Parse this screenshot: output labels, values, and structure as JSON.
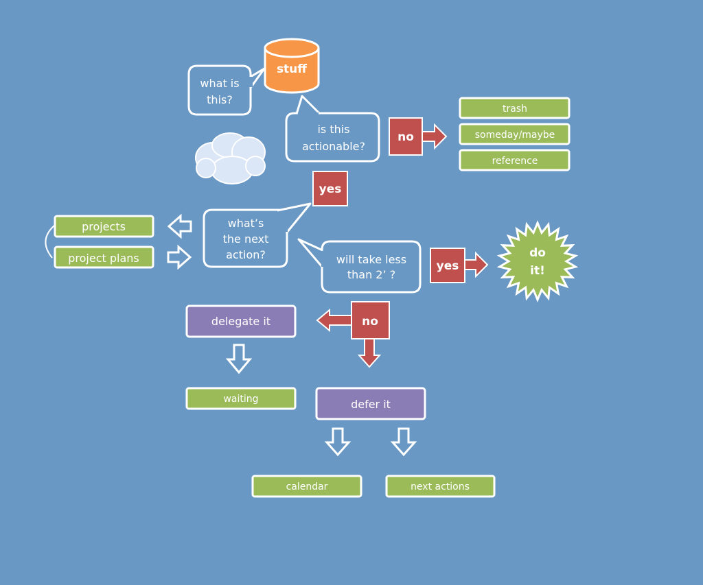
{
  "colors": {
    "background": "#6a98c4",
    "bucket": "#f79646",
    "category": "#9bbb59",
    "decision": "#c0504d",
    "action": "#8a7cb4",
    "do_it": "#9bbb59",
    "cloud": "#dbe6f7"
  },
  "nodes": {
    "stuff": "stuff",
    "what_is_this": [
      "what is",
      "this?"
    ],
    "is_actionable": [
      "is this",
      "actionable?"
    ],
    "no_1": "no",
    "trash": "trash",
    "someday": "someday/maybe",
    "reference": "reference",
    "yes_1": "yes",
    "next_action": [
      "what’s",
      "the next",
      "action?"
    ],
    "projects": "projects",
    "project_plans": "project plans",
    "two_minutes": [
      "will take less",
      "than 2’ ?"
    ],
    "yes_2": "yes",
    "do_it": [
      "do",
      "it!"
    ],
    "no_2": "no",
    "delegate": "delegate it",
    "waiting": "waiting",
    "defer": "defer it",
    "calendar": "calendar",
    "next_actions": "next actions"
  }
}
